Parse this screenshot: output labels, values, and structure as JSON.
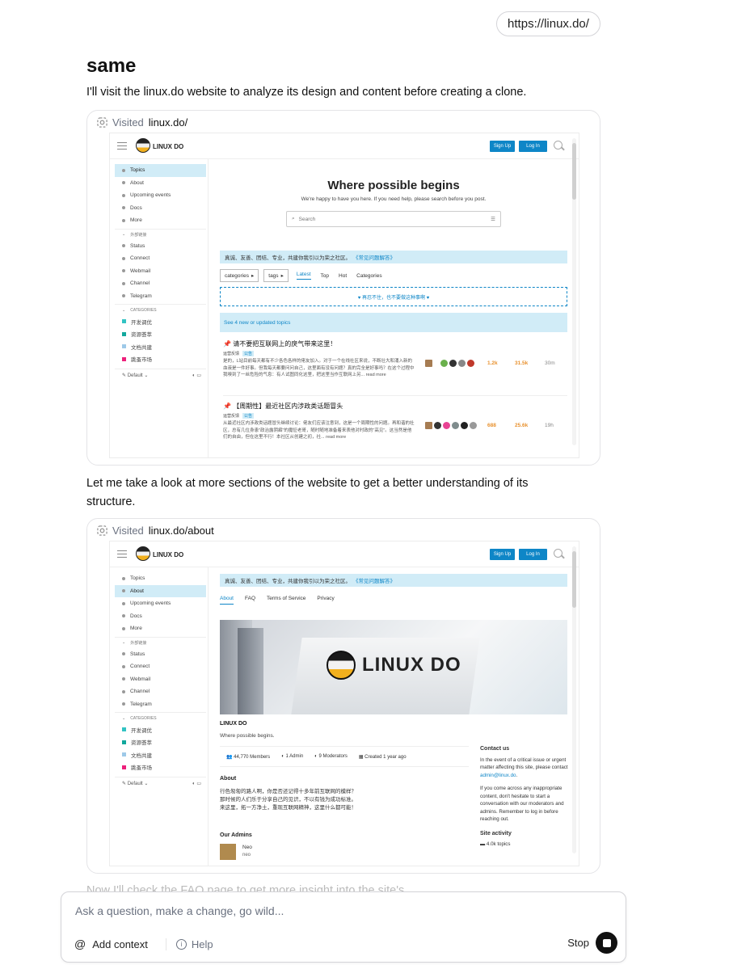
{
  "url_pill": "https://linux.do/",
  "heading": "same",
  "messages": {
    "m1": "I'll visit the linux.do website to analyze its design and content before creating a clone.",
    "m2a": "Let me take a look at more sections of the website to get a better understanding of its",
    "m2b": "structure.",
    "m3": "Now I'll check the FAQ page to get more insight into the site's"
  },
  "visit1": {
    "prefix": "Visited",
    "target": "linux.do/"
  },
  "visit2": {
    "prefix": "Visited",
    "target": "linux.do/about"
  },
  "site": {
    "logo_text": "LINUX DO",
    "signup": "Sign Up",
    "login": "Log In",
    "sidebar": [
      "Topics",
      "About",
      "Upcoming events",
      "Docs",
      "More"
    ],
    "sidebar_sec": "外部链接",
    "sidebar_links": [
      "Status",
      "Connect",
      "Webmail",
      "Channel",
      "Telegram"
    ],
    "categories_title": "CATEGORIES",
    "categories": [
      {
        "label": "开发调优",
        "color": "#32c3c3"
      },
      {
        "label": "资源荟萃",
        "color": "#12a89d"
      },
      {
        "label": "文档共建",
        "color": "#9ec9e8"
      },
      {
        "label": "跳蚤市场",
        "color": "#ed207b"
      }
    ],
    "footer_default": "Default",
    "hero_title": "Where possible begins",
    "hero_sub": "We're happy to have you here. If you need help, please search before you post.",
    "search_placeholder": "Search",
    "banner_text": "真诚、友善、团结、专业，共建你我引以为荣之社区。",
    "banner_link": "《常见问题解答》",
    "nav_categories": "categories",
    "nav_tags": "tags",
    "nav_tabs": [
      "Latest",
      "Top",
      "Hot",
      "Categories"
    ],
    "dashed_notice": "♥ 再忍不住，也不要做这种事啊 ♥",
    "new_topics": "See 4 new or updated topics",
    "topics": [
      {
        "title": "请不要把互联网上的戾气带来这里！",
        "cat": "运营反馈",
        "tag": "公告",
        "excerpt": "是的，L站目前每天都有不少各色各样的佬友加入。对于一个在线社区来说，不断壮大和涌入新的血液是一件好事。但我每天都要问问自己，这里面有没有问题？真的完全是好事吗？在这个过程中我嗅到了一丝危险的气息：有人试图同化这里，把这里当作互联网上另... read more",
        "replies": "1.2k",
        "views": "31.5k",
        "age": "30m"
      },
      {
        "title": "【周期性】最近社区内涉政类话题冒头",
        "cat": "运营反馈",
        "tag": "公告",
        "excerpt": "从最近社区内涉政类话题冒头继续讨论：佬友们应该注意到，这是一个周期性的问题。再和谐的社区，总有几位身患\"政治露阴癖\"的魔怔老哥，随时随地准备着来表他对时政的\"高见\"。这当然是他们的自由，但在这里不行！本社区从创建之初，社... read more",
        "replies": "688",
        "views": "25.6k",
        "age": "19h"
      }
    ],
    "about_tabs": [
      "About",
      "FAQ",
      "Terms of Service",
      "Privacy"
    ],
    "about_name": "LINUX DO",
    "about_tagline": "Where possible begins.",
    "stats": [
      "44,770 Members",
      "1 Admin",
      "9 Moderators",
      "Created 1 year ago"
    ],
    "about_heading": "About",
    "about_p": [
      "行色匆匆的路人啊，你是否还记得十多年前互联网的模样？",
      "那时候的人们乐于分享自己的见识，不以有钱为成功标准。",
      "来这里，拓一方净土，重现互联网精神，这里什么都可能！"
    ],
    "contact_h": "Contact us",
    "contact_p1": "In the event of a critical issue or urgent matter affecting this site, please contact",
    "contact_email": "admin@linux.do",
    "contact_p2": "If you come across any inappropriate content, don't hesitate to start a conversation with our moderators and admins. Remember to log in before reaching out.",
    "activity_h": "Site activity",
    "activity_item": "4.0k topics",
    "admins_h": "Our Admins",
    "admin_name": "Neo",
    "admin_user": "neo"
  },
  "chat": {
    "placeholder": "Ask a question, make a change, go wild...",
    "add_context": "Add context",
    "help": "Help",
    "stop": "Stop"
  }
}
